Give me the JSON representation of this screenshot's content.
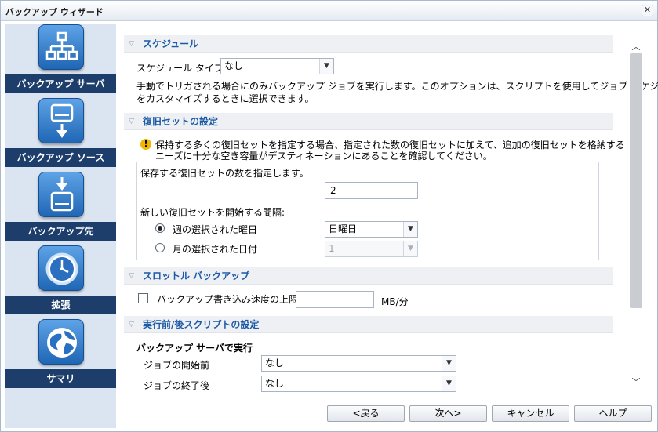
{
  "window": {
    "title": "バックアップ ウィザード",
    "close_symbol": "✕"
  },
  "nav": {
    "items": [
      {
        "label": "バックアップ サーバ",
        "icon": "server-tree-icon"
      },
      {
        "label": "バックアップ ソース",
        "icon": "drive-arrow-down-icon"
      },
      {
        "label": "バックアップ先",
        "icon": "drive-arrow-in-icon"
      },
      {
        "label": "拡張",
        "icon": "clock-icon"
      },
      {
        "label": "サマリ",
        "icon": "globe-icon"
      }
    ]
  },
  "schedule": {
    "header": "スケジュール",
    "type_label": "スケジュール タイプ",
    "type_value": "なし",
    "description_line1": "手動でトリガされる場合にのみバックアップ ジョブを実行します。このオプションは、スクリプトを使用してジョブ スケジュール",
    "description_line2": "をカスタマイズするときに選択できます。"
  },
  "recovery": {
    "header": "復旧セットの設定",
    "warning_line1": "保持する多くの復旧セットを指定する場合、指定された数の復旧セットに加えて、追加の復旧セットを格納する",
    "warning_line2": "ニーズに十分な空き容量がデスティネーションにあることを確認してください。",
    "count_label": "保存する復旧セットの数を指定します。",
    "count_value": "2",
    "interval_label": "新しい復旧セットを開始する間隔:",
    "weekday_label": "週の選択された曜日",
    "weekday_value": "日曜日",
    "monthday_label": "月の選択された日付",
    "monthday_value": "1"
  },
  "throttle": {
    "header": "スロットル バックアップ",
    "limit_label": "バックアップ書き込み速度の上限:",
    "limit_value": "",
    "unit": "MB/分"
  },
  "scripts": {
    "header": "実行前/後スクリプトの設定",
    "subheader": "バックアップ サーバで実行",
    "before_label": "ジョブの開始前",
    "before_value": "なし",
    "after_label": "ジョブの終了後",
    "after_value": "なし"
  },
  "buttons": {
    "back": "<戻る",
    "next": "次へ>",
    "cancel": "キャンセル",
    "help": "ヘルプ"
  },
  "colors": {
    "nav_label_bg": "#1d3d6b",
    "nav_bg": "#dbe4f1",
    "section_title": "#1a5aa6"
  }
}
